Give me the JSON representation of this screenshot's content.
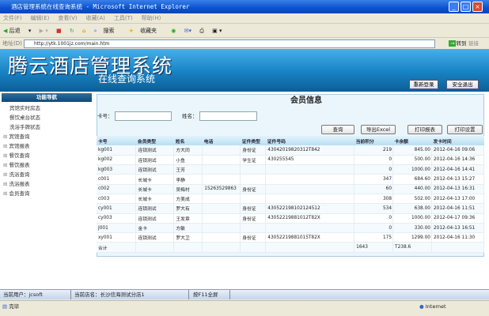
{
  "window": {
    "title": "酒店管理系统在线查询系统 - Microsoft Internet Explorer"
  },
  "menu": [
    "文件(F)",
    "编辑(E)",
    "查看(V)",
    "收藏(A)",
    "工具(T)",
    "帮助(H)"
  ],
  "toolbar": {
    "back": "后退",
    "search": "搜索",
    "favorites": "收藏夹"
  },
  "address": {
    "label": "地址(D)",
    "url": "http://ytk.1001jz.com/main.htm",
    "go": "转到",
    "links": "链接"
  },
  "header": {
    "title": "腾云酒店管理系统",
    "subtitle": "在线查询系统",
    "relogin": "重新登录",
    "logout": "安全退出"
  },
  "sidebar": {
    "title": "功能导航",
    "items": [
      {
        "label": "宾馆实时房态",
        "expandable": false
      },
      {
        "label": "餐饮桌台状态",
        "expandable": false
      },
      {
        "label": "洗浴手牌状态",
        "expandable": false
      },
      {
        "label": "宾馆查询",
        "expandable": true
      },
      {
        "label": "宾馆报表",
        "expandable": true
      },
      {
        "label": "餐饮查询",
        "expandable": true
      },
      {
        "label": "餐饮报表",
        "expandable": true
      },
      {
        "label": "洗浴查询",
        "expandable": true
      },
      {
        "label": "洗浴报表",
        "expandable": true
      },
      {
        "label": "会员查询",
        "expandable": true
      }
    ]
  },
  "main": {
    "title": "会员信息",
    "card_label": "卡号：",
    "card_value": "",
    "name_label": "姓名：",
    "name_value": "",
    "buttons": {
      "query": "查询",
      "export": "导出Excel",
      "print": "打印报表",
      "print_setup": "打印设置"
    },
    "columns": [
      "卡号",
      "会员类型",
      "姓名",
      "电话",
      "证件类型",
      "证件号码",
      "当前积分",
      "卡余额",
      "发卡时间"
    ],
    "rows": [
      [
        "kg001",
        "连锁测试",
        "方大同",
        "",
        "身份证",
        "43042019820312T842",
        "219",
        "845.00",
        "2012-04-16 09:06"
      ],
      [
        "kg002",
        "连锁测试",
        "小鱼",
        "",
        "学生证",
        "430255545",
        "0",
        "500.00",
        "2012-04-16 14:36"
      ],
      [
        "kg003",
        "连锁测试",
        "王芳",
        "",
        "",
        "",
        "0",
        "1000.00",
        "2012-04-16 14:41"
      ],
      [
        "c001",
        "长城卡",
        "李静",
        "",
        "",
        "",
        "347",
        "684.60",
        "2012-04-13 15:27"
      ],
      [
        "c002",
        "长城卡",
        "吴梅村",
        "15263529863",
        "身份证",
        "",
        "60",
        "440.00",
        "2012-04-13 16:31"
      ],
      [
        "c003",
        "长城卡",
        "方美成",
        "",
        "",
        "",
        "308",
        "502.00",
        "2012-04-13 17:00"
      ],
      [
        "cy001",
        "连锁测试",
        "罗大有",
        "",
        "身份证",
        "430522198102124512",
        "534",
        "638.00",
        "2012-04-16 11:51"
      ],
      [
        "cy003",
        "连锁测试",
        "王发章",
        "",
        "身份证",
        "43052219881012T82X",
        "0",
        "1000.00",
        "2012-04-17 09:36"
      ],
      [
        "J001",
        "金卡",
        "方敏",
        "",
        "",
        "",
        "0",
        "330.00",
        "2012-04-13 16:51"
      ],
      [
        "xy001",
        "连锁测试",
        "罗大卫",
        "",
        "身份证",
        "43052219881015T82X",
        "175",
        "1299.00",
        "2012-04-16 11:30"
      ]
    ],
    "total": [
      "合计",
      "",
      "",
      "",
      "",
      "",
      "1643",
      "T238.6",
      ""
    ]
  },
  "status": {
    "user": "当前用户：jcsoft",
    "store": "当前店名：长沙信海测试分店1",
    "fullscreen": "按F11全屏"
  },
  "ie_status": {
    "done": "完毕",
    "zone": "Internet"
  }
}
